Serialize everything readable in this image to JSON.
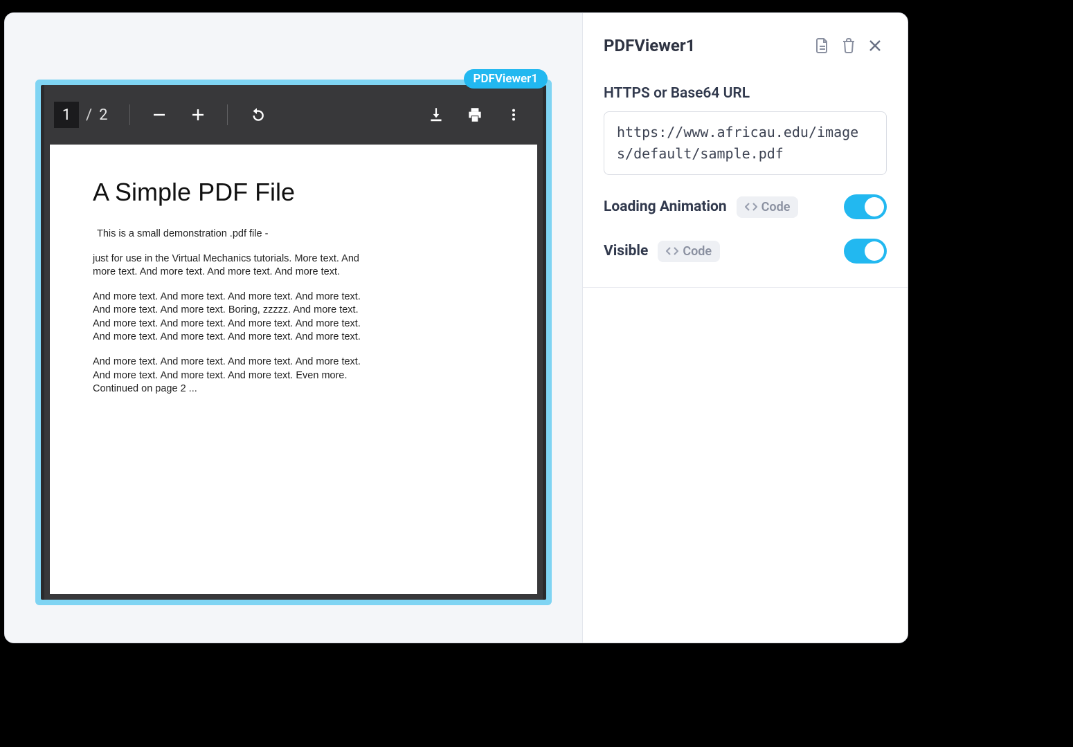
{
  "widget": {
    "label": "PDFViewer1"
  },
  "pdf_toolbar": {
    "current_page": "1",
    "page_separator": "/",
    "total_pages": "2"
  },
  "pdf_document": {
    "title": "A Simple PDF File",
    "paragraphs": [
      "This is a small demonstration .pdf file -",
      "just for use in the Virtual Mechanics tutorials. More text. And more text. And more text. And more text. And more text.",
      "And more text. And more text. And more text. And more text. And more text. And more text. Boring, zzzzz. And more text. And more text. And more text. And more text. And more text. And more text. And more text. And more text. And more text.",
      "And more text. And more text. And more text. And more text. And more text. And more text. And more text. Even more. Continued on page 2 ..."
    ]
  },
  "inspector": {
    "title": "PDFViewer1",
    "url_label": "HTTPS or Base64 URL",
    "url_value": "https://www.africau.edu/images/default/sample.pdf",
    "props": {
      "loading_animation": {
        "label": "Loading Animation",
        "code_chip": "Code",
        "value": true
      },
      "visible": {
        "label": "Visible",
        "code_chip": "Code",
        "value": true
      }
    }
  }
}
